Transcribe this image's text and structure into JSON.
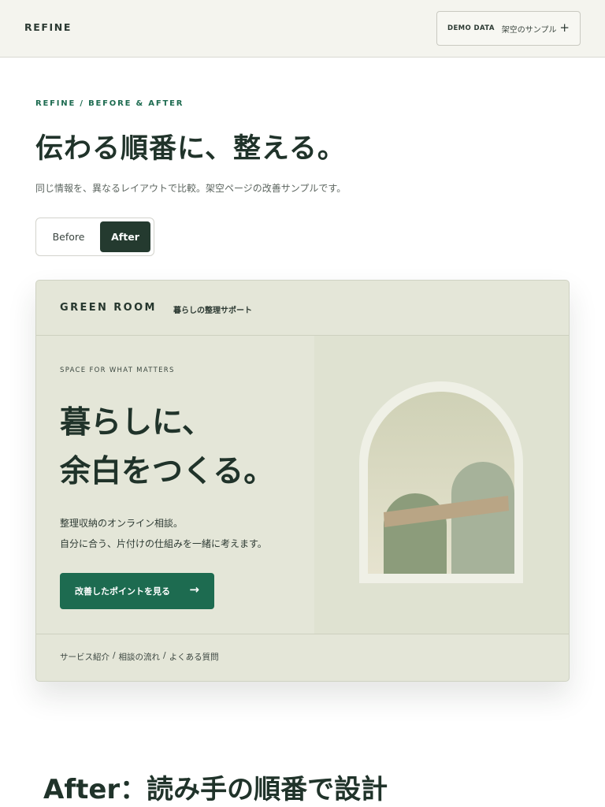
{
  "header": {
    "brand": "REFINE",
    "demo_label": "DEMO DATA",
    "demo_sub": "架空のサンプル",
    "demo_icon": "plus-icon"
  },
  "intro": {
    "eyebrow": "REFINE / BEFORE & AFTER",
    "headline": "伝わる順番に、整える。",
    "lead": "同じ情報を、異なるレイアウトで比較。架空ページの改善サンプルです。"
  },
  "toggle": {
    "before": "Before",
    "after": "After",
    "selected": "After"
  },
  "preview": {
    "logo": "GREEN ROOM",
    "tagline": "暮らしの整理サポート",
    "kicker": "SPACE FOR WHAT MATTERS",
    "title_line1": "暮らしに、",
    "title_line2": "余白をつくる。",
    "body_line1": "整理収納のオンライン相談。",
    "body_line2": "自分に合う、片付けの仕組みを一緒に考えます。",
    "cta_label": "改善したポイントを見る",
    "cta_icon": "arrow-right-icon",
    "footer_links": [
      "サービス紹介",
      "相談の流れ",
      "よくある質問"
    ],
    "footer_separator": "/"
  },
  "section": {
    "title": "After：読み手の順番で設計"
  },
  "colors": {
    "accent": "#1d6b50",
    "dark": "#243a2f",
    "card_bg": "#e4e6d8"
  }
}
